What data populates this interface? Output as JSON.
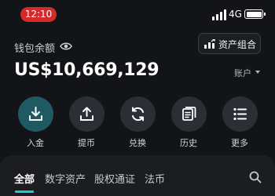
{
  "status_bar": {
    "time": "12:10",
    "network": "4G"
  },
  "wallet": {
    "label": "钱包余额",
    "balance": "US$10,669,129",
    "account_label": "账户",
    "portfolio_button": "资产组合"
  },
  "actions": [
    {
      "label": "入金",
      "icon": "deposit-icon"
    },
    {
      "label": "提币",
      "icon": "withdraw-icon"
    },
    {
      "label": "兑换",
      "icon": "exchange-icon"
    },
    {
      "label": "历史",
      "icon": "history-icon"
    },
    {
      "label": "更多",
      "icon": "more-icon"
    }
  ],
  "tabs": [
    {
      "label": "全部",
      "active": true
    },
    {
      "label": "数字资产",
      "active": false
    },
    {
      "label": "股权通证",
      "active": false
    },
    {
      "label": "法币",
      "active": false
    }
  ],
  "colors": {
    "background": "#121417",
    "accent": "#2ec5d3",
    "time_pill": "#d42a2a",
    "primary_action": "#1f5a63"
  }
}
